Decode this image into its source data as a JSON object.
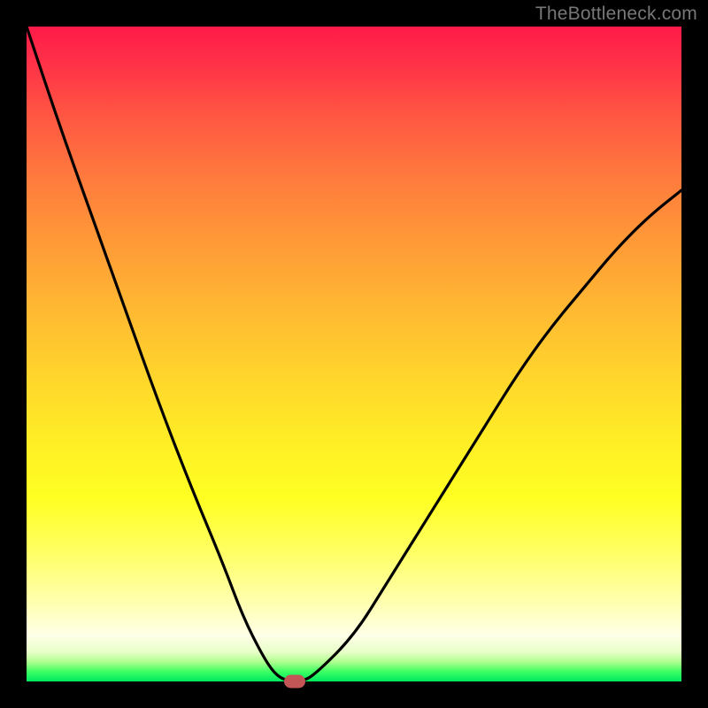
{
  "watermark": "TheBottleneck.com",
  "chart_data": {
    "type": "line",
    "title": "",
    "xlabel": "",
    "ylabel": "",
    "xlim": [
      0,
      1
    ],
    "ylim": [
      0,
      1
    ],
    "grid": false,
    "legend": false,
    "series": [
      {
        "name": "curve",
        "x": [
          0.0,
          0.05,
          0.1,
          0.15,
          0.2,
          0.25,
          0.3,
          0.33,
          0.36,
          0.38,
          0.4,
          0.42,
          0.44,
          0.5,
          0.55,
          0.6,
          0.65,
          0.7,
          0.75,
          0.8,
          0.85,
          0.9,
          0.95,
          1.0
        ],
        "y": [
          1.0,
          0.85,
          0.71,
          0.57,
          0.43,
          0.3,
          0.18,
          0.1,
          0.04,
          0.01,
          0.0,
          0.0,
          0.01,
          0.07,
          0.15,
          0.23,
          0.31,
          0.39,
          0.47,
          0.54,
          0.6,
          0.66,
          0.71,
          0.75
        ]
      }
    ],
    "marker": {
      "x": 0.41,
      "y": 0.0
    },
    "background_gradient": {
      "top": "#ff1a49",
      "mid": "#ffff22",
      "bottom": "#00e860"
    }
  }
}
